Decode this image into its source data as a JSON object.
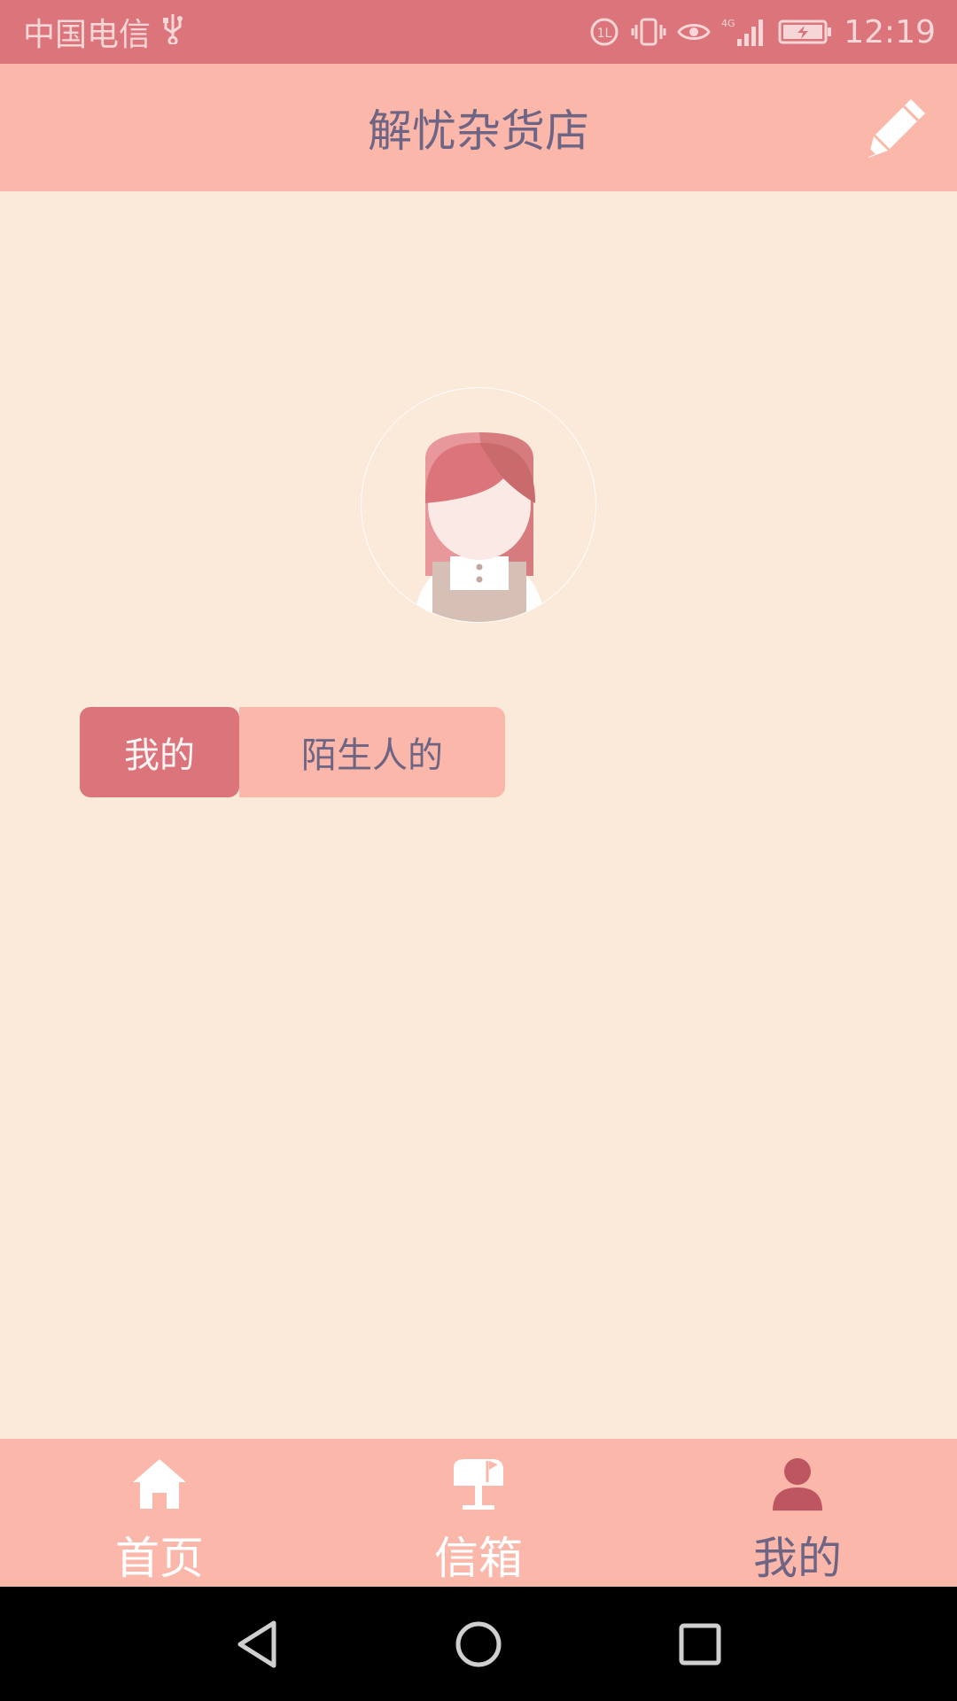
{
  "status_bar": {
    "carrier": "中国电信",
    "network": "4G",
    "time": "12:19"
  },
  "header": {
    "title": "解忧杂货店",
    "edit_icon": "pencil-icon"
  },
  "profile": {
    "avatar": "girl-avatar"
  },
  "tabs": [
    {
      "label": "我的",
      "active": true
    },
    {
      "label": "陌生人的",
      "active": false
    }
  ],
  "bottom_nav": [
    {
      "label": "首页",
      "icon": "home-icon",
      "active": false
    },
    {
      "label": "信箱",
      "icon": "mailbox-icon",
      "active": false
    },
    {
      "label": "我的",
      "icon": "user-icon",
      "active": true
    }
  ],
  "colors": {
    "status_bar": "#dc757b",
    "header": "#fab7aa",
    "background": "#fbe9da",
    "accent": "#dc757b",
    "text": "#6e6584"
  }
}
